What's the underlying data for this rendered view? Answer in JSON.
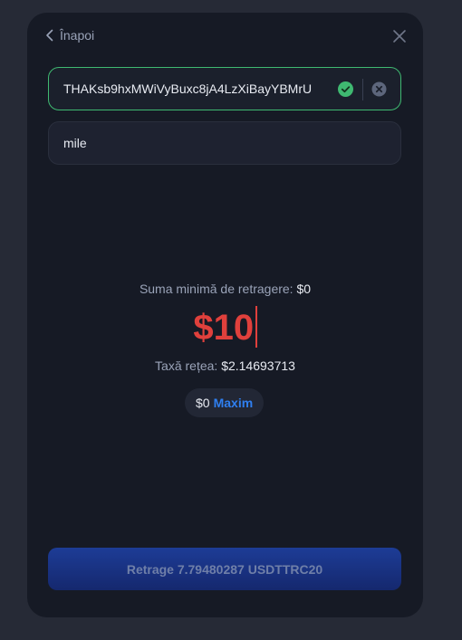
{
  "header": {
    "back_label": "Înapoi"
  },
  "address": {
    "value": "THAKsb9hxMWiVyBuxc8jA4LzXiBayYBMrU"
  },
  "memo": {
    "value": "mile"
  },
  "minimum": {
    "label": "Suma minimă de retragere:",
    "value": "$0"
  },
  "amount": {
    "value": "$10"
  },
  "fee": {
    "label": "Taxă rețea:",
    "value": "$2.14693713"
  },
  "balance": {
    "value": "$0",
    "max_label": "Maxim"
  },
  "withdraw": {
    "label": "Retrage 7.79480287 USDTTRC20"
  },
  "colors": {
    "valid": "#3fb971",
    "amount": "#e0403c",
    "accent": "#2f7ff0"
  }
}
